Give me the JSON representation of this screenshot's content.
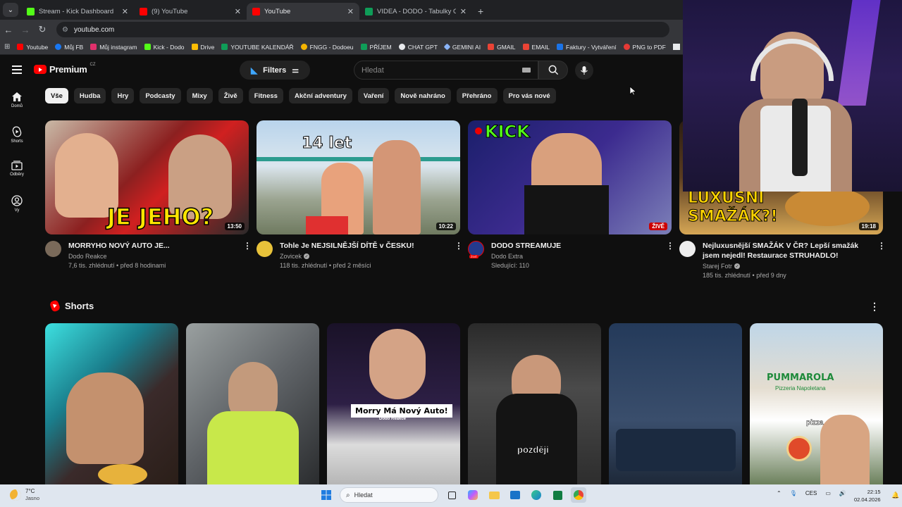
{
  "browser": {
    "tabs": [
      {
        "title": "Stream - Kick Dashboard",
        "favicon_color": "#53fc18",
        "active": false
      },
      {
        "title": "(9) YouTube",
        "favicon_color": "#ff0000",
        "active": false
      },
      {
        "title": "YouTube",
        "favicon_color": "#ff0000",
        "active": true
      },
      {
        "title": "VIDEA - DODO - Tabulky Googl",
        "favicon_color": "#0f9d58",
        "active": false
      }
    ],
    "url": "youtube.com",
    "bookmarks": [
      {
        "label": "Youtube",
        "color": "#ff0000"
      },
      {
        "label": "Můj FB",
        "color": "#1877f2"
      },
      {
        "label": "Můj instagram",
        "color": "#e1306c"
      },
      {
        "label": "Kick - Dodo",
        "color": "#53fc18"
      },
      {
        "label": "Drive",
        "color": "#fbbc04"
      },
      {
        "label": "YOUTUBE KALENDÁŘ",
        "color": "#0f9d58"
      },
      {
        "label": "FNGG - Dodoeu",
        "color": "#f4b400"
      },
      {
        "label": "PŘÍJEM",
        "color": "#0f9d58"
      },
      {
        "label": "CHAT GPT",
        "color": "#e8eaed"
      },
      {
        "label": "GEMINI AI",
        "color": "#8ab4f8"
      },
      {
        "label": "GMAIL",
        "color": "#ea4335"
      },
      {
        "label": "EMAIL",
        "color": "#ea4335"
      },
      {
        "label": "Faktury - Vytváření",
        "color": "#1a73e8"
      },
      {
        "label": "PNG to PDF",
        "color": "#e53935"
      }
    ]
  },
  "youtube": {
    "logo_text": "Premium",
    "logo_region": "CZ",
    "filters_label": "Filters",
    "search_placeholder": "Hledat",
    "nav": [
      {
        "label": "Domů",
        "icon": "home-icon"
      },
      {
        "label": "Shorts",
        "icon": "shorts-icon"
      },
      {
        "label": "Odběry",
        "icon": "subscriptions-icon"
      },
      {
        "label": "Vy",
        "icon": "account-icon"
      }
    ],
    "chips": [
      "Vše",
      "Hudba",
      "Hry",
      "Podcasty",
      "Mixy",
      "Živě",
      "Fitness",
      "Akční adventury",
      "Vaření",
      "Nově nahráno",
      "Přehráno",
      "Pro vás nové"
    ],
    "active_chip": "Vše",
    "videos": [
      {
        "title": "MORRYHO NOVÝ AUTO JE...",
        "channel": "Dodo Reakce",
        "stats": "7,6 tis. zhlédnutí • před 8 hodinami",
        "duration": "13:50",
        "thumb_text": "JE JEHO?",
        "verified": false
      },
      {
        "title": "Tohle Je NEJSILNĚJŠÍ DÍTĚ v ČESKU!",
        "channel": "Zovicek",
        "stats": "118 tis. zhlédnutí • před 2 měsíci",
        "duration": "10:22",
        "thumb_text": "14 let",
        "verified": true
      },
      {
        "title": "DODO STREAMUJE",
        "channel": "Dodo Extra",
        "stats": "Sledující: 110",
        "duration": "ŽIVĚ",
        "thumb_text": "KICK",
        "verified": false
      },
      {
        "title": "Nejluxusnější SMAŽÁK V ČR? Lepší smažák jsem nejedl! Restaurace STRUHADLO!",
        "channel": "Starej Fotr",
        "stats": "185 tis. zhlédnutí • před 9 dny",
        "duration": "19:18",
        "thumb_text": "LUXUSNÍ SMAŽÁK?!",
        "verified": true
      }
    ],
    "live_avatar_label": "ŽIVĚ",
    "shorts_title": "Shorts",
    "shorts": [
      {
        "caption": ""
      },
      {
        "caption": ""
      },
      {
        "caption": "Morry Má Nový Auto!",
        "sub": "Dodo Reakce"
      },
      {
        "caption": "později"
      },
      {
        "caption": ""
      },
      {
        "caption": "pizza",
        "sign": "PUMMAROLA",
        "sign_sub": "Pizzeria Napoletana"
      }
    ]
  },
  "taskbar": {
    "weather_temp": "7°C",
    "weather_desc": "Jasno",
    "search_placeholder": "Hledat",
    "lang": "CES",
    "time": "22:15",
    "date": "02.04.2026"
  }
}
